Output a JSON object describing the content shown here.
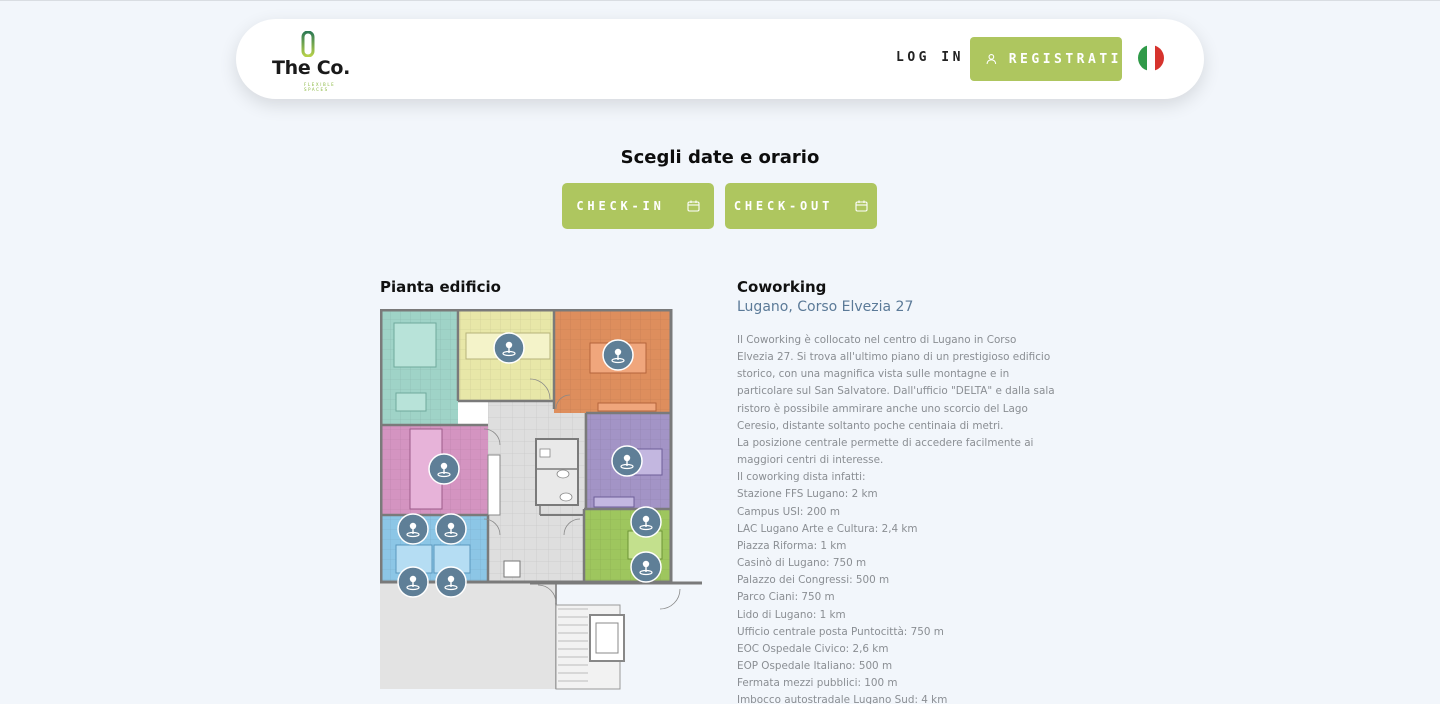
{
  "header": {
    "logo_text": "The Co.",
    "logo_sub": "FLEXIBLE SPACES",
    "login_label": "LOG IN",
    "register_label": "REGISTRATI",
    "language": "Italiano"
  },
  "booking": {
    "title": "Scegli date e orario",
    "checkin_label": "CHECK-IN",
    "checkout_label": "CHECK-OUT"
  },
  "plan": {
    "title": "Pianta edificio",
    "rooms": [
      {
        "name": "teal",
        "color": "#9fd3c7"
      },
      {
        "name": "yellow",
        "color": "#e8e7a8"
      },
      {
        "name": "orange",
        "color": "#de8e5d"
      },
      {
        "name": "pink",
        "color": "#d494c1"
      },
      {
        "name": "purple",
        "color": "#a394c6"
      },
      {
        "name": "blue",
        "color": "#8cc6e6"
      },
      {
        "name": "green",
        "color": "#9ec65e"
      }
    ]
  },
  "info": {
    "title": "Coworking",
    "location": "Lugano, Corso Elvezia 27",
    "description_lines": [
      "Il Coworking è collocato nel centro di Lugano in Corso",
      "Elvezia 27. Si trova all'ultimo piano di un prestigioso edificio",
      "storico, con una magnifica vista sulle montagne e in",
      "particolare sul San Salvatore. Dall'ufficio \"DELTA\" e dalla sala",
      "ristoro è possibile ammirare anche uno scorcio del Lago",
      "Ceresio, distante soltanto poche centinaia di metri.",
      "La posizione centrale permette di accedere facilmente ai",
      "maggiori centri di interesse.",
      "Il coworking dista infatti:",
      "Stazione FFS Lugano: 2 km",
      "Campus USI: 200 m",
      "LAC Lugano Arte e Cultura: 2,4 km",
      "Piazza Riforma: 1 km",
      "Casinò di Lugano: 750 m",
      "Palazzo dei Congressi: 500 m",
      "Parco Ciani: 750 m",
      "Lido di Lugano: 1 km",
      "Ufficio centrale posta Puntocittà: 750 m",
      "EOC Ospedale Civico: 2,6 km",
      "EOP Ospedale Italiano: 500 m",
      "Fermata mezzi pubblici: 100 m",
      "Imbocco autostradale Lugano Sud: 4 km"
    ]
  },
  "colors": {
    "accent": "#aec65f",
    "background": "#f2f6fb",
    "location_text": "#5b7a98",
    "pin": "#5f7f97"
  }
}
